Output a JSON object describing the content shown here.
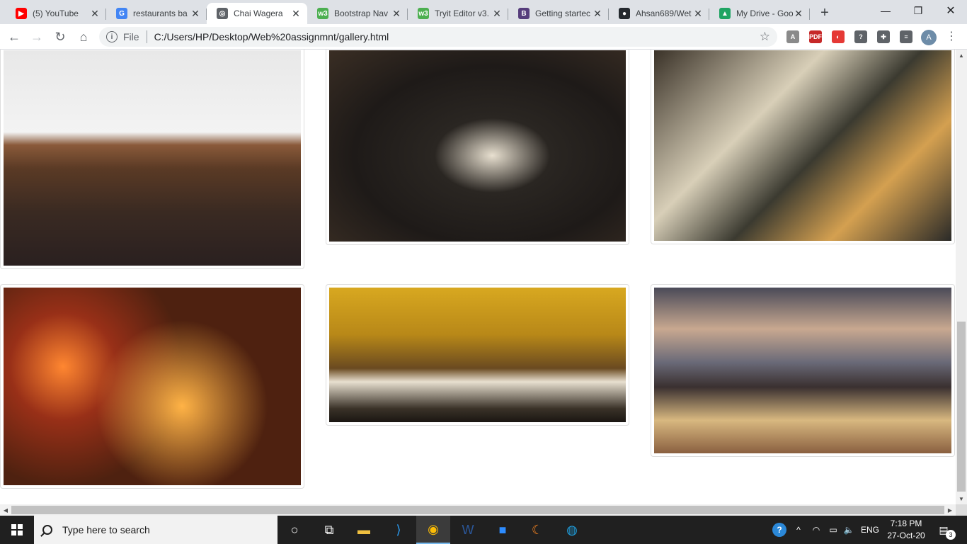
{
  "browser": {
    "tabs": [
      {
        "title": "(5) YouTube",
        "icon": "youtube-icon",
        "color": "#ff0000",
        "glyph": "▶"
      },
      {
        "title": "restaurants ba",
        "icon": "google-icon",
        "color": "#4285f4",
        "glyph": "G"
      },
      {
        "title": "Chai Wagera",
        "icon": "globe-icon",
        "color": "#5f6368",
        "glyph": "◎",
        "active": true
      },
      {
        "title": "Bootstrap Nav",
        "icon": "w3schools-icon",
        "color": "#4caf50",
        "glyph": "w3"
      },
      {
        "title": "Tryit Editor v3.",
        "icon": "w3schools-icon",
        "color": "#4caf50",
        "glyph": "w3"
      },
      {
        "title": "Getting startec",
        "icon": "bootstrap-icon",
        "color": "#563d7c",
        "glyph": "B"
      },
      {
        "title": "Ahsan689/Wet",
        "icon": "github-icon",
        "color": "#24292e",
        "glyph": "●"
      },
      {
        "title": "My Drive - Goo",
        "icon": "google-drive-icon",
        "color": "#1fa463",
        "glyph": "▲"
      }
    ],
    "new_tab_glyph": "+",
    "window_controls": {
      "minimize": "—",
      "restore": "❐",
      "close": "✕"
    },
    "nav": {
      "back": "←",
      "forward": "→",
      "reload": "↻",
      "home": "⌂"
    },
    "address": {
      "scheme_label": "File",
      "url": "C:/Users/HP/Desktop/Web%20assignmnt/gallery.html"
    },
    "extensions": [
      {
        "name": "acrobat-icon",
        "color": "#8a8a8a",
        "glyph": "A"
      },
      {
        "name": "pdf-icon",
        "color": "#c62828",
        "glyph": "PDF"
      },
      {
        "name": "pokeball-icon",
        "color": "#e53935",
        "glyph": "◐"
      },
      {
        "name": "help-icon",
        "color": "#5f6368",
        "glyph": "?"
      },
      {
        "name": "puzzle-icon",
        "color": "#5f6368",
        "glyph": "✚"
      },
      {
        "name": "playlist-icon",
        "color": "#5f6368",
        "glyph": "≡"
      }
    ],
    "profile_initial": "A",
    "menu_glyph": "⋮"
  },
  "gallery": {
    "images": [
      {
        "name": "gallery-image-white-brick-restaurant"
      },
      {
        "name": "gallery-image-dark-cafe-tables"
      },
      {
        "name": "gallery-image-upscale-dining-table"
      },
      {
        "name": "gallery-image-blurred-night-lights"
      },
      {
        "name": "gallery-image-open-kitchen-bar"
      },
      {
        "name": "gallery-image-beach-candlelit-dinner"
      }
    ]
  },
  "taskbar": {
    "search_placeholder": "Type here to search",
    "pinned": [
      {
        "name": "cortana-icon",
        "glyph": "○"
      },
      {
        "name": "task-view-icon",
        "glyph": "⧉"
      },
      {
        "name": "file-explorer-icon",
        "glyph": "▬",
        "color": "#f0c040"
      },
      {
        "name": "vscode-icon",
        "glyph": "⟩",
        "color": "#2b9bf0"
      },
      {
        "name": "chrome-icon",
        "glyph": "◉",
        "color": "#fbbc05",
        "active": true
      },
      {
        "name": "word-icon",
        "glyph": "W",
        "color": "#2b579a"
      },
      {
        "name": "zoom-icon",
        "glyph": "■",
        "color": "#2d8cff"
      },
      {
        "name": "eclipse-icon",
        "glyph": "☾",
        "color": "#f08020"
      },
      {
        "name": "edge-icon",
        "glyph": "◍",
        "color": "#1fa0e0"
      }
    ],
    "tray": {
      "help": "?",
      "chevron": "^",
      "network": "◠",
      "battery": "▭",
      "volume": "🔈",
      "language": "ENG"
    },
    "time": "7:18 PM",
    "date": "27-Oct-20",
    "notifications_count": "3"
  }
}
